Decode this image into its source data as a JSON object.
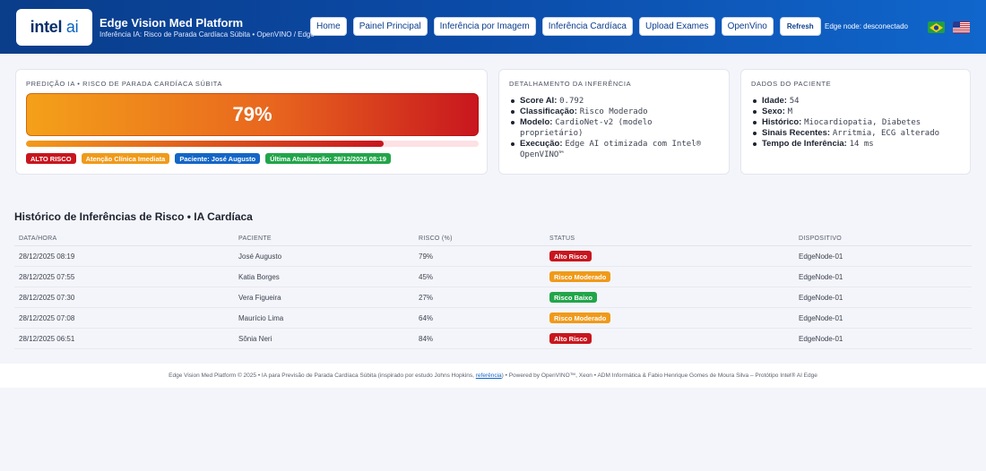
{
  "header": {
    "logo": {
      "intel": "intel",
      "ai": "ai"
    },
    "title": "Edge Vision Med Platform",
    "subtitle": "Inferência IA: Risco de Parada Cardíaca Súbita • OpenVINO / Edge",
    "nav": [
      "Home",
      "Painel Principal",
      "Inferência por Imagem",
      "Inferência Cardíaca",
      "Upload Exames",
      "OpenVino"
    ],
    "refresh_label": "Refresh",
    "edge_status": "Edge node: desconectado",
    "flags": [
      "flag-brazil-icon",
      "flag-usa-icon"
    ],
    "accent_color": "#0b4aa6"
  },
  "risk_card": {
    "title": "PREDIÇÃO IA • RISCO DE PARADA CARDÍACA SÚBITA",
    "value": "79%",
    "progress_fraction": 0.79,
    "badges": {
      "alert": "ALTO RISCO",
      "attention": "Atenção Clínica Imediata",
      "patient": "Paciente: José Augusto",
      "updated": "Última Atualização: 28/12/2025 08:19"
    }
  },
  "inference_card": {
    "title": "DETALHAMENTO DA INFERÊNCIA",
    "items": [
      {
        "key": "Score AI:",
        "value": "0.792"
      },
      {
        "key": "Classificação:",
        "value": "Risco Moderado"
      },
      {
        "key": "Modelo:",
        "value": "CardioNet-v2 (modelo proprietário)"
      },
      {
        "key": "Execução:",
        "value": "Edge AI otimizada com Intel® OpenVINO™"
      }
    ]
  },
  "patient_card": {
    "title": "DADOS DO PACIENTE",
    "items": [
      {
        "key": "Idade:",
        "value": "54"
      },
      {
        "key": "Sexo:",
        "value": "M"
      },
      {
        "key": "Histórico:",
        "value": "Miocardiopatia, Diabetes"
      },
      {
        "key": "Sinais Recentes:",
        "value": "Arritmia, ECG alterado"
      },
      {
        "key": "Tempo de Inferência:",
        "value": "14 ms"
      }
    ]
  },
  "history": {
    "title": "Histórico de Inferências de Risco • IA Cardíaca",
    "columns": [
      "DATA/HORA",
      "PACIENTE",
      "RISCO (%)",
      "STATUS",
      "DISPOSITIVO"
    ],
    "rows": [
      {
        "datetime": "28/12/2025 08:19",
        "patient": "José Augusto",
        "risk": "79%",
        "status": "Alto Risco",
        "status_color": "#c8161e",
        "device": "EdgeNode-01"
      },
      {
        "datetime": "28/12/2025 07:55",
        "patient": "Katia Borges",
        "risk": "45%",
        "status": "Risco Moderado",
        "status_color": "#f09a1a",
        "device": "EdgeNode-01"
      },
      {
        "datetime": "28/12/2025 07:30",
        "patient": "Vera Figueira",
        "risk": "27%",
        "status": "Risco Baixo",
        "status_color": "#22a54a",
        "device": "EdgeNode-01"
      },
      {
        "datetime": "28/12/2025 07:08",
        "patient": "Maurício Lima",
        "risk": "64%",
        "status": "Risco Moderado",
        "status_color": "#f09a1a",
        "device": "EdgeNode-01"
      },
      {
        "datetime": "28/12/2025 06:51",
        "patient": "Sônia Neri",
        "risk": "84%",
        "status": "Alto Risco",
        "status_color": "#c8161e",
        "device": "EdgeNode-01"
      }
    ]
  },
  "footer": {
    "text_before": "Edge Vision Med Platform © 2025 • IA para Previsão de Parada Cardíaca Súbita (inspirado por estudo Johns Hopkins, ",
    "link": "referência",
    "text_after": ") • Powered by OpenVINO™, Xeon • ADM Informática & Fabio Henrique Gomes de Moura Silva – Protótipo Intel® AI Edge"
  }
}
